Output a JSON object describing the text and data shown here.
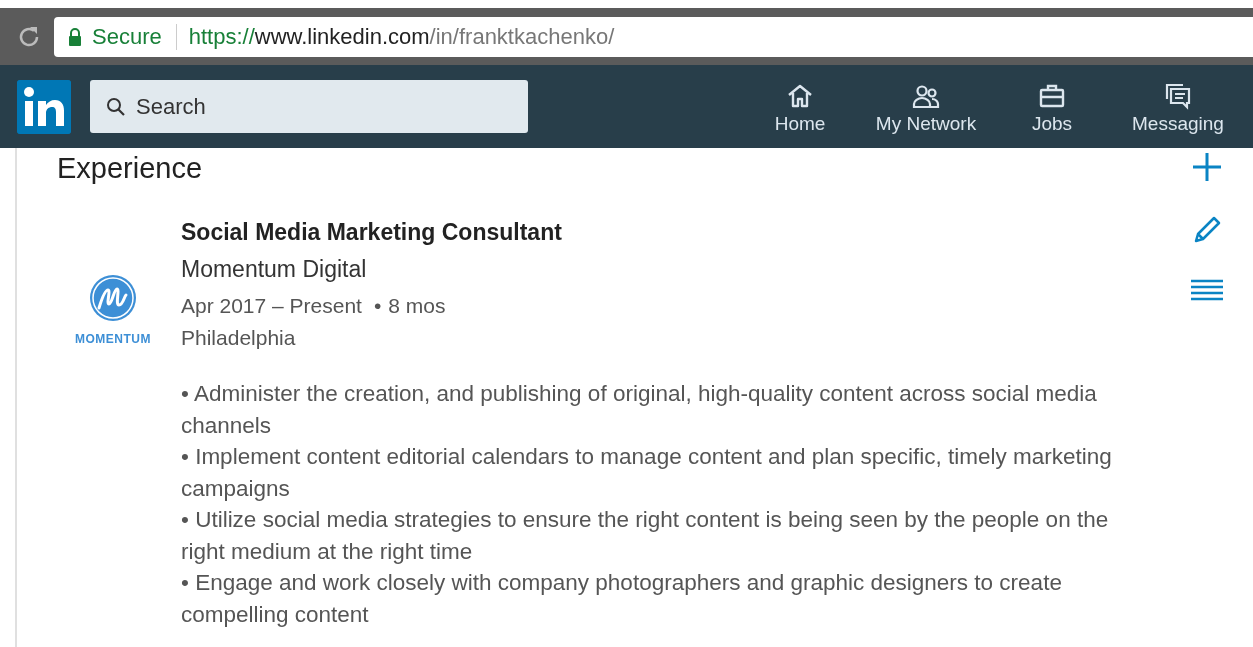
{
  "browser": {
    "security": "Secure",
    "url": {
      "scheme": "https://",
      "host": "www.linkedin.com",
      "path": "/in/franktkachenko/"
    }
  },
  "nav": {
    "search": {
      "placeholder": "Search"
    },
    "items": [
      {
        "label": "Home",
        "kind": "home"
      },
      {
        "label": "My Network",
        "kind": "network"
      },
      {
        "label": "Jobs",
        "kind": "jobs"
      },
      {
        "label": "Messaging",
        "kind": "messaging"
      }
    ]
  },
  "experience": {
    "heading": "Experience",
    "positions": [
      {
        "title": "Social Media Marketing Consultant",
        "company": "Momentum Digital",
        "logo_text": "MOMENTUM",
        "dates": "Apr 2017 – Present",
        "separator": "•",
        "duration": "8 mos",
        "location": "Philadelphia",
        "description": [
          "• Administer the creation, and publishing of original, high-quality content across social media channels",
          "• Implement content editorial calendars to manage content and plan specific, timely marketing campaigns",
          "• Utilize social media strategies to ensure the right content is being seen by the people on the right medium at the right time",
          "• Engage and work closely with company photographers and graphic designers to create compelling content"
        ]
      }
    ]
  }
}
